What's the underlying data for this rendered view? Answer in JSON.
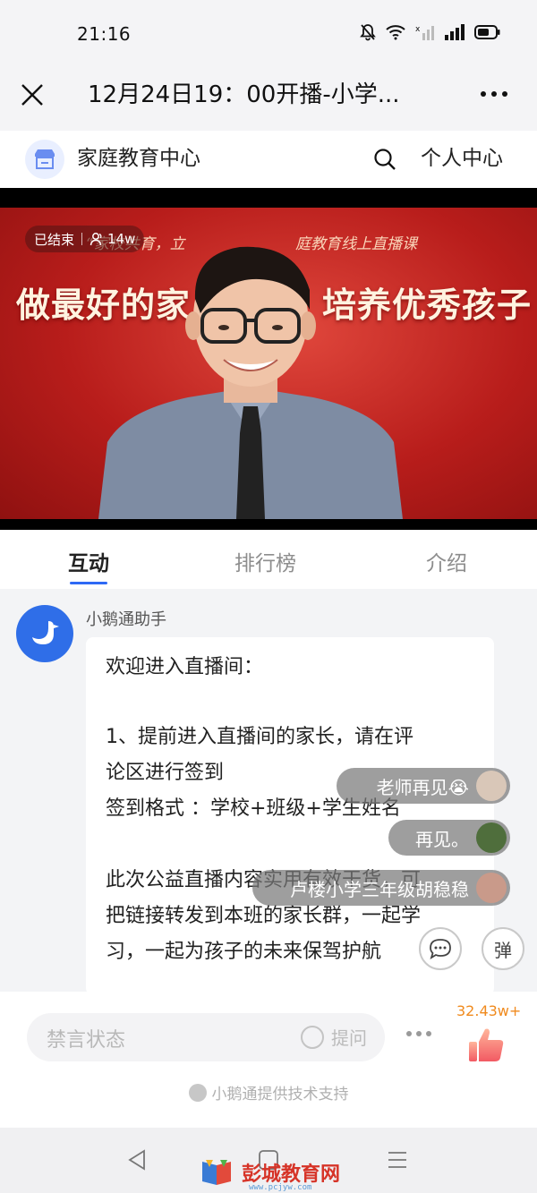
{
  "status_bar": {
    "time": "21:16"
  },
  "title_bar": {
    "title": "12月24日19：00开播-小学..."
  },
  "shop": {
    "name": "家庭教育中心",
    "personal_center": "个人中心"
  },
  "video": {
    "status": "已结束",
    "viewers": "14w",
    "banner_subtitle_left": "“家校共育，立",
    "banner_subtitle_right": "庭教育线上直播课",
    "banner_main_left": "做最好的家",
    "banner_main_right": "培养优秀孩子"
  },
  "tabs": [
    {
      "label": "互动",
      "active": true
    },
    {
      "label": "排行榜",
      "active": false
    },
    {
      "label": "介绍",
      "active": false
    }
  ],
  "chat": {
    "sender": "小鹅通助手",
    "lines": [
      "欢迎进入直播间：",
      "",
      "1、提前进入直播间的家长，请在评",
      "论区进行签到",
      "签到格式 ：学校+班级+学生姓名",
      "",
      "此次公益直播内容实用有效干货，可",
      "把链接转发到本班的家长群，一起学",
      "习，一起为孩子的未来保驾护航"
    ]
  },
  "danmaku": [
    {
      "text": "老师再见😭"
    },
    {
      "text": "再见。"
    },
    {
      "text": "卢楼小学三年级胡稳稳"
    }
  ],
  "actions": {
    "barrage_label": "弹"
  },
  "input": {
    "placeholder": "禁言状态",
    "ask_label": "提问"
  },
  "likes": {
    "count": "32.43w+"
  },
  "footer": {
    "support": "小鹅通提供技术支持"
  },
  "watermark": {
    "text": "彭城教育网",
    "url": "www.pcjyw.com"
  },
  "colors": {
    "accent": "#2e69f5",
    "like": "#f08a1d",
    "video_red": "#c0201c"
  }
}
